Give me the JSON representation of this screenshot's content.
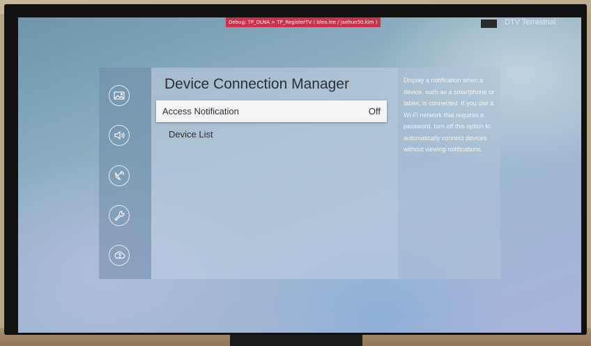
{
  "debug_banner": "Debug: TP_DLNA > TP_RegisterTV  ( bleo.lee / jaehun50.kim )",
  "source_label": "DTV Terrestrial",
  "rail_icons": [
    "picture-icon",
    "sound-icon",
    "broadcasting-icon",
    "general-wrench-icon",
    "support-icon"
  ],
  "menu": {
    "title": "Device Connection Manager",
    "items": [
      {
        "label": "Access Notification",
        "value": "Off"
      },
      {
        "label": "Device List"
      }
    ]
  },
  "description": "Display a notification when a device, such as a smartphone or tablet, is connected. If you use a Wi-Fi network that requires a password, turn off this option to automatically connect devices without viewing notifications.",
  "colors": {
    "banner": "#c8324a",
    "focus_background": "#f4f5f6"
  }
}
